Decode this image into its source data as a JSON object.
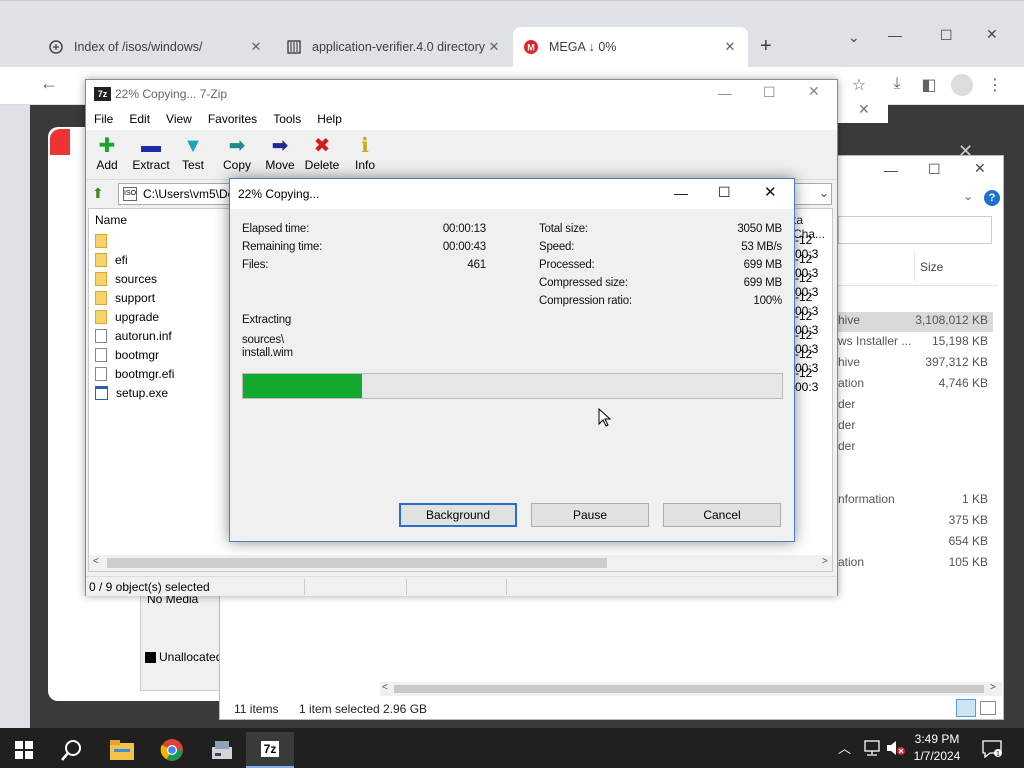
{
  "browser": {
    "tabs": [
      {
        "label": "Index of /isos/windows/"
      },
      {
        "label": "application-verifier.4.0 directory"
      },
      {
        "label": "MEGA ↓ 0%"
      }
    ]
  },
  "mega": {
    "no_media": "No Media",
    "unallocated": "Unallocated"
  },
  "explorer": {
    "size_header": "Size",
    "rows": [
      {
        "type": "hive",
        "size": "3,108,012 KB"
      },
      {
        "type": "ws Installer ...",
        "size": "15,198 KB"
      },
      {
        "type": "hive",
        "size": "397,312 KB"
      },
      {
        "type": "ation",
        "size": "4,746 KB"
      },
      {
        "type": "der",
        "size": ""
      },
      {
        "type": "der",
        "size": ""
      },
      {
        "type": "der",
        "size": ""
      },
      {
        "type": "nformation",
        "size": "1 KB"
      },
      {
        "type": "",
        "size": "375 KB"
      },
      {
        "type": "",
        "size": "654 KB"
      },
      {
        "type": "ation",
        "size": "105 KB"
      }
    ],
    "status_items": "11 items",
    "status_selected": "1 item selected",
    "status_size": "2.96 GB"
  },
  "sevenzip": {
    "title": "22% Copying... 7-Zip",
    "menu": [
      "File",
      "Edit",
      "View",
      "Favorites",
      "Tools",
      "Help"
    ],
    "toolbar": [
      "Add",
      "Extract",
      "Test",
      "Copy",
      "Move",
      "Delete",
      "Info"
    ],
    "address": "C:\\Users\\vm5\\De",
    "name_header": "Name",
    "date_header": "ta Cha...",
    "files": [
      {
        "name": "",
        "kind": "folder"
      },
      {
        "name": "efi",
        "kind": "folder"
      },
      {
        "name": "sources",
        "kind": "folder"
      },
      {
        "name": "support",
        "kind": "folder"
      },
      {
        "name": "upgrade",
        "kind": "folder"
      },
      {
        "name": "autorun.inf",
        "kind": "file"
      },
      {
        "name": "bootmgr",
        "kind": "file"
      },
      {
        "name": "bootmgr.efi",
        "kind": "file"
      },
      {
        "name": "setup.exe",
        "kind": "exe"
      }
    ],
    "dates": [
      "-12 00:3",
      "-12 00:3",
      "-12 00:3",
      "-12 00:3",
      "-12 00:3",
      "-12 00:3",
      "-12 00:3",
      "-12 00:3"
    ],
    "status": "0 / 9 object(s) selected"
  },
  "dialog": {
    "title": "22% Copying...",
    "elapsed_label": "Elapsed time:",
    "elapsed": "00:00:13",
    "remaining_label": "Remaining time:",
    "remaining": "00:00:43",
    "files_label": "Files:",
    "files": "461",
    "total_label": "Total size:",
    "total": "3050 MB",
    "speed_label": "Speed:",
    "speed": "53 MB/s",
    "processed_label": "Processed:",
    "processed": "699 MB",
    "compressed_label": "Compressed size:",
    "compressed": "699 MB",
    "ratio_label": "Compression ratio:",
    "ratio": "100%",
    "action": "Extracting",
    "path1": "sources\\",
    "path2": "install.wim",
    "progress_percent": 22,
    "buttons": {
      "background": "Background",
      "pause": "Pause",
      "cancel": "Cancel"
    }
  },
  "taskbar": {
    "time": "3:49 PM",
    "date": "1/7/2024"
  },
  "colors": {
    "progress": "#12aa2e",
    "accent": "#4a7cc8"
  }
}
